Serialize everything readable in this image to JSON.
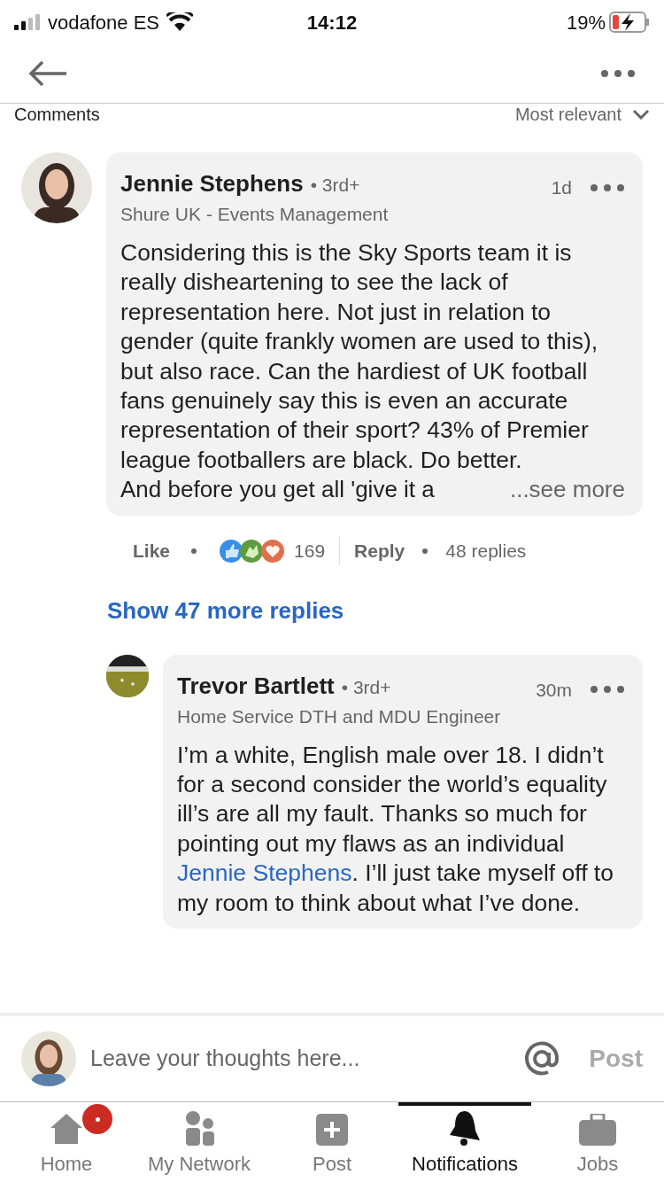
{
  "status_bar": {
    "carrier": "vodafone ES",
    "time": "14:12",
    "battery": "19%"
  },
  "section": {
    "title": "Comments",
    "sort": "Most relevant"
  },
  "comment": {
    "author": "Jennie Stephens",
    "degree": "• 3rd+",
    "headline": "Shure UK - Events Management",
    "time": "1d",
    "text": "Considering this is the Sky Sports team it is really disheartening to see the lack of representation here. Not just in relation to gender (quite frankly women are used to this), but also race. Can the hardiest of UK football fans genuinely say this is even an accurate representation of their sport? 43% of Premier league footballers are black. Do better.",
    "last_line": "And before you get all 'give it a",
    "see_more": "...see more"
  },
  "actions": {
    "like": "Like",
    "reaction_count": "169",
    "reply": "Reply",
    "replies": "48 replies"
  },
  "show_more": "Show 47 more replies",
  "reply": {
    "author": "Trevor Bartlett",
    "degree": "• 3rd+",
    "headline": "Home Service DTH and MDU Engineer",
    "time": "30m",
    "text_before": "I’m a white, English male over 18. I didn’t for a second consider the world’s equality ill’s are all my fault. Thanks so much for pointing out my flaws as an individual ",
    "mention": "Jennie Stephens",
    "text_after": ". I’ll just take myself off to my room to think about what I’ve done."
  },
  "composer": {
    "placeholder": "Leave your thoughts here...",
    "post": "Post"
  },
  "tabs": [
    {
      "label": "Home",
      "kind": "home",
      "selected": false,
      "badge": true
    },
    {
      "label": "My Network",
      "kind": "network",
      "selected": false,
      "badge": false
    },
    {
      "label": "Post",
      "kind": "post",
      "selected": false,
      "badge": false
    },
    {
      "label": "Notifications",
      "kind": "bell",
      "selected": true,
      "badge": false
    },
    {
      "label": "Jobs",
      "kind": "jobs",
      "selected": false,
      "badge": false
    }
  ]
}
